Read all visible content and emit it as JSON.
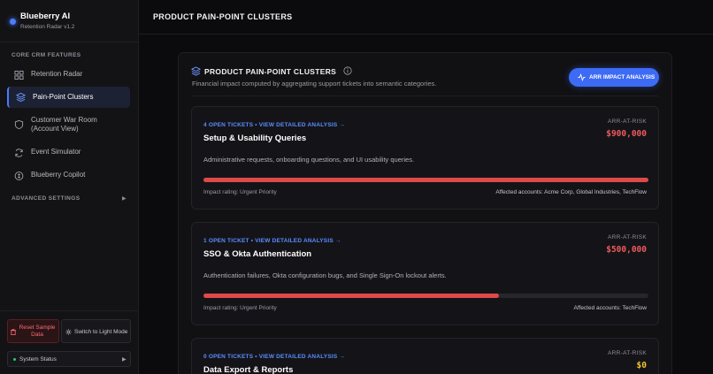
{
  "app": {
    "name": "Blueberry AI",
    "version": "Retention Radar v1.2"
  },
  "sidebar": {
    "core_section": "CORE CRM FEATURES",
    "items": [
      {
        "label": "Retention Radar",
        "icon": "grid-icon"
      },
      {
        "label": "Pain-Point Clusters",
        "icon": "layers-icon",
        "active": true
      },
      {
        "label": "Customer War Room (Account View)",
        "icon": "shield-icon"
      },
      {
        "label": "Event Simulator",
        "icon": "refresh-icon"
      },
      {
        "label": "Blueberry Copilot",
        "icon": "copilot-icon"
      }
    ],
    "advanced_section": "ADVANCED SETTINGS",
    "reset_label": "Reset Sample Data",
    "light_mode_label": "Switch to Light Mode",
    "status_label": "System Status"
  },
  "header": {
    "title": "PRODUCT PAIN-POINT CLUSTERS"
  },
  "panel": {
    "title": "PRODUCT PAIN-POINT CLUSTERS",
    "subtitle": "Financial impact computed by aggregating support tickets into semantic categories.",
    "button_label": "ARR IMPACT ANALYSIS"
  },
  "clusters": [
    {
      "link": "4 OPEN TICKETS • VIEW DETAILED ANALYSIS →",
      "title": "Setup & Usability Queries",
      "description": "Administrative requests, onboarding questions, and UI usability queries.",
      "risk_label": "ARR-AT-RISK",
      "risk_value": "$900,000",
      "risk_color": "#f05a5e",
      "impact_fraction": 1.0,
      "impact_rating": "Impact rating: Urgent Priority",
      "accounts": "Affected accounts: Acme Corp, Global Industries, TechFlow"
    },
    {
      "link": "1 OPEN TICKET • VIEW DETAILED ANALYSIS →",
      "title": "SSO & Okta Authentication",
      "description": "Authentication failures, Okta configuration bugs, and Single Sign-On lockout alerts.",
      "risk_label": "ARR-AT-RISK",
      "risk_value": "$500,000",
      "risk_color": "#f05a5e",
      "impact_fraction": 0.665,
      "impact_rating": "Impact rating: Urgent Priority",
      "accounts": "Affected accounts: TechFlow"
    },
    {
      "link": "0 OPEN TICKETS • VIEW DETAILED ANALYSIS →",
      "title": "Data Export & Reports",
      "risk_label": "ARR-AT-RISK",
      "risk_value": "$0",
      "risk_color": "#f2c230"
    }
  ]
}
